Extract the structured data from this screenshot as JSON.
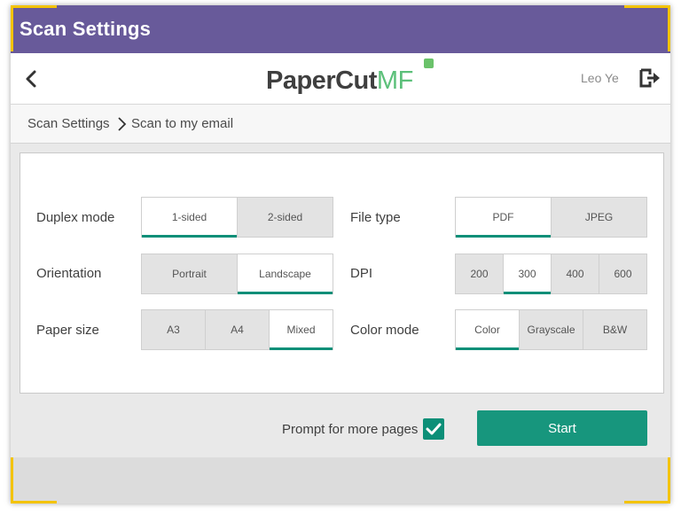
{
  "window": {
    "title": "Scan Settings"
  },
  "header": {
    "logo_text": "PaperCut",
    "logo_suffix": "MF",
    "user_name": "Leo Ye"
  },
  "breadcrumb": {
    "parent": "Scan Settings",
    "current": "Scan to my email"
  },
  "settings": {
    "duplex": {
      "label": "Duplex mode",
      "options": [
        "1-sided",
        "2-sided"
      ],
      "selected": "1-sided"
    },
    "orientation": {
      "label": "Orientation",
      "options": [
        "Portrait",
        "Landscape"
      ],
      "selected": "Landscape"
    },
    "paper_size": {
      "label": "Paper size",
      "options": [
        "A3",
        "A4",
        "Mixed"
      ],
      "selected": "Mixed"
    },
    "file_type": {
      "label": "File type",
      "options": [
        "PDF",
        "JPEG"
      ],
      "selected": "PDF"
    },
    "dpi": {
      "label": "DPI",
      "options": [
        "200",
        "300",
        "400",
        "600"
      ],
      "selected": "300"
    },
    "color_mode": {
      "label": "Color mode",
      "options": [
        "Color",
        "Grayscale",
        "B&W"
      ],
      "selected": "Color"
    }
  },
  "footer": {
    "prompt_label": "Prompt for more pages",
    "prompt_checked": true,
    "start_label": "Start"
  },
  "colors": {
    "title_bar": "#685a9a",
    "accent": "#0c8f78",
    "corner_marker": "#f3c300"
  },
  "icons": {
    "back": "chevron-left-icon",
    "logout": "logout-icon",
    "breadcrumb_separator": "chevron-right-icon",
    "checkbox": "checkmark-icon"
  }
}
